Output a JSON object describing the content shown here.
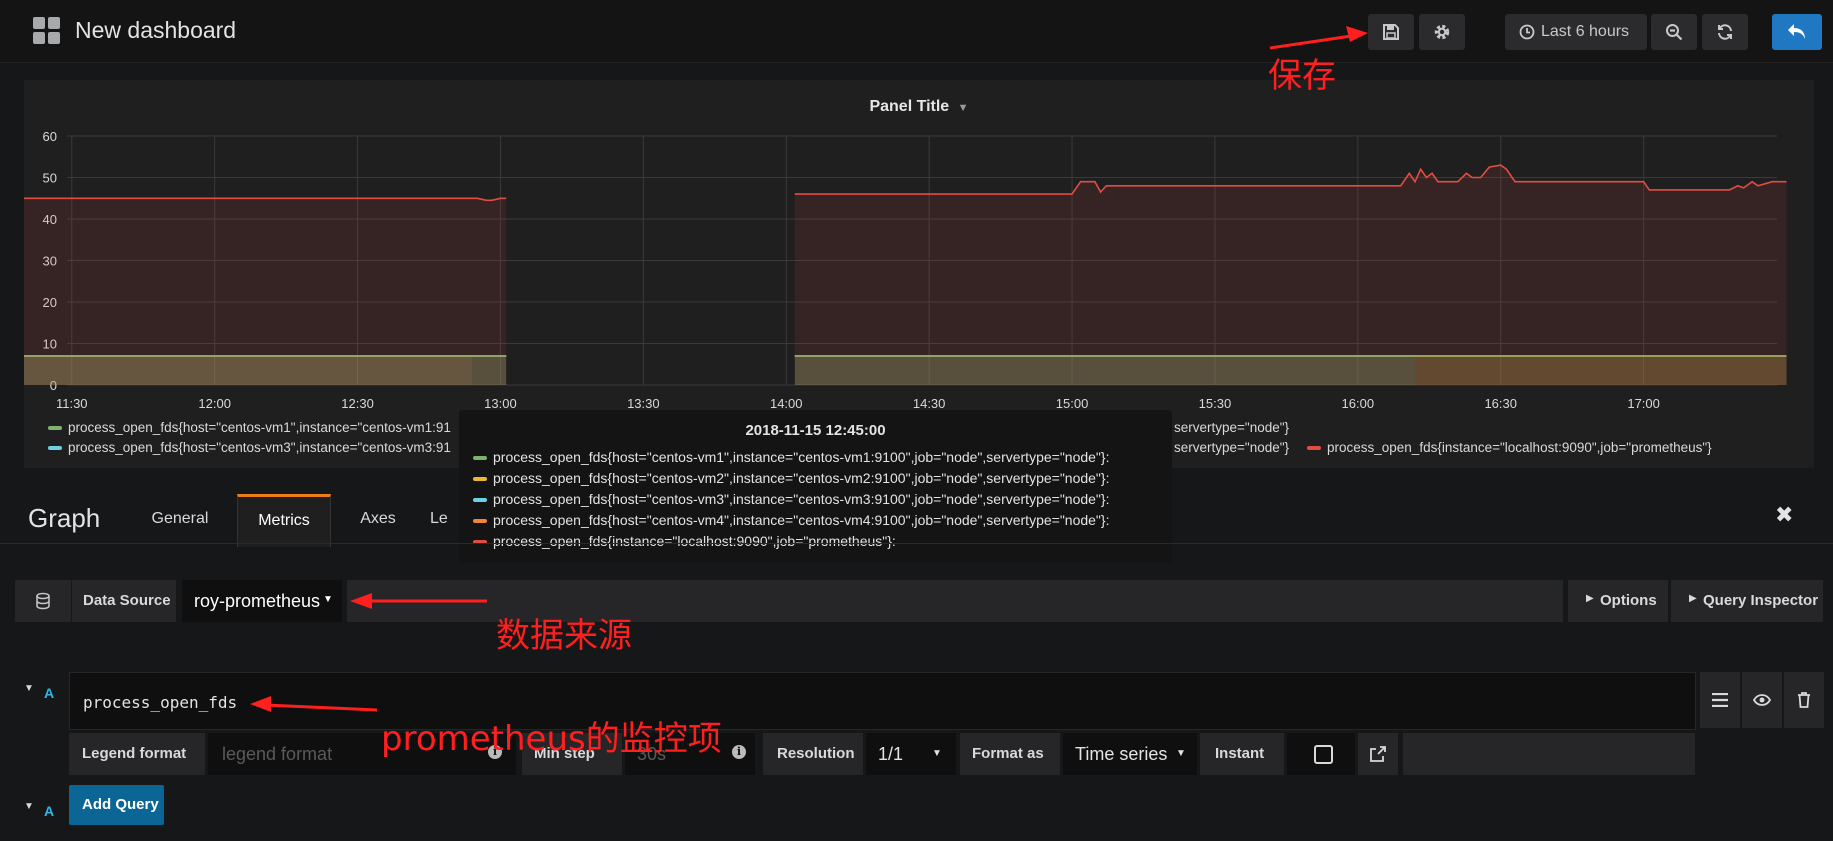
{
  "topbar": {
    "title": "New dashboard",
    "time_range": "Last 6 hours"
  },
  "panel": {
    "title": "Panel Title",
    "legend": [
      {
        "label": "process_open_fds{host=\"centos-vm1\",instance=\"centos-vm1:91",
        "color": "#7eb26d"
      },
      {
        "label": "servertype=\"node\"}",
        "color": "#eab839"
      },
      {
        "label": "process_open_fds{host=\"centos-vm3\",instance=\"centos-vm3:91",
        "color": "#6ed0e0"
      },
      {
        "label": "servertype=\"node\"}",
        "color": "#ef843c"
      },
      {
        "label": "process_open_fds{instance=\"localhost:9090\",job=\"prometheus\"}",
        "color": "#e24d42"
      }
    ]
  },
  "chart_data": {
    "type": "line",
    "title": "Panel Title",
    "ylim": [
      0,
      60
    ],
    "yticks": [
      "0",
      "10",
      "20",
      "30",
      "40",
      "50",
      "60"
    ],
    "xticks": [
      "11:30",
      "12:00",
      "12:30",
      "13:00",
      "13:30",
      "14:00",
      "14:30",
      "15:00",
      "15:30",
      "16:00",
      "16:30",
      "17:00"
    ],
    "grid": true,
    "series": [
      {
        "name": "process_open_fds{instance=\"localhost:9090\",job=\"prometheus\"}",
        "color": "#e24d42",
        "segments": [
          [
            [
              11.33,
              45
            ],
            [
              12.92,
              45
            ],
            [
              12.95,
              44.5
            ],
            [
              12.97,
              44.5
            ],
            [
              13.0,
              45
            ],
            [
              13.02,
              45
            ]
          ],
          [
            [
              14.03,
              46
            ],
            [
              15.0,
              46
            ],
            [
              15.03,
              49
            ],
            [
              15.08,
              49
            ],
            [
              15.1,
              46.5
            ],
            [
              15.12,
              48
            ],
            [
              16.0,
              48
            ],
            [
              16.15,
              48
            ],
            [
              16.18,
              51
            ],
            [
              16.2,
              49
            ],
            [
              16.22,
              52
            ],
            [
              16.24,
              50
            ],
            [
              16.26,
              51
            ],
            [
              16.28,
              49
            ],
            [
              16.35,
              49
            ],
            [
              16.38,
              51
            ],
            [
              16.4,
              50
            ],
            [
              16.43,
              50
            ],
            [
              16.46,
              52.5
            ],
            [
              16.5,
              53
            ],
            [
              16.52,
              52
            ],
            [
              16.55,
              49
            ],
            [
              17.0,
              49
            ],
            [
              17.02,
              47
            ],
            [
              17.3,
              47
            ],
            [
              17.33,
              48
            ],
            [
              17.35,
              47.5
            ],
            [
              17.38,
              49
            ],
            [
              17.4,
              48
            ],
            [
              17.45,
              49
            ],
            [
              17.5,
              49
            ]
          ]
        ]
      },
      {
        "name": "process_open_fds{host=\"centos-vm1\",instance=\"centos-vm1:9100\",job=\"node\",servertype=\"node\"}",
        "color": "#7eb26d",
        "segments": [
          [
            [
              11.33,
              7
            ],
            [
              13.02,
              7
            ]
          ],
          [
            [
              14.03,
              7
            ],
            [
              17.5,
              7
            ]
          ]
        ]
      },
      {
        "name": "process_open_fds{host=\"centos-vm2\",instance=\"centos-vm2:9100\",job=\"node\",servertype=\"node\"}",
        "color": "#eab839",
        "segments": [
          [
            [
              11.33,
              7
            ],
            [
              13.02,
              7
            ]
          ],
          [
            [
              14.03,
              7
            ],
            [
              17.5,
              7
            ]
          ]
        ]
      },
      {
        "name": "process_open_fds{host=\"centos-vm3\",instance=\"centos-vm3:9100\",job=\"node\",servertype=\"node\"}",
        "color": "#6ed0e0",
        "segments": [
          [
            [
              11.33,
              7
            ],
            [
              13.02,
              7
            ]
          ],
          [
            [
              14.03,
              7
            ],
            [
              16.2,
              7
            ]
          ]
        ]
      },
      {
        "name": "process_open_fds{host=\"centos-vm4\",instance=\"centos-vm4:9100\",job=\"node\",servertype=\"node\"}",
        "color": "#ef843c",
        "segments": [
          [
            [
              11.33,
              7
            ],
            [
              12.9,
              7
            ]
          ],
          [
            [
              16.2,
              7
            ],
            [
              17.5,
              7
            ]
          ]
        ]
      }
    ]
  },
  "tooltip": {
    "title": "2018-11-15 12:45:00",
    "rows": [
      {
        "label": "process_open_fds{host=\"centos-vm1\",instance=\"centos-vm1:9100\",job=\"node\",servertype=\"node\"}:",
        "color": "#7eb26d"
      },
      {
        "label": "process_open_fds{host=\"centos-vm2\",instance=\"centos-vm2:9100\",job=\"node\",servertype=\"node\"}:",
        "color": "#eab839"
      },
      {
        "label": "process_open_fds{host=\"centos-vm3\",instance=\"centos-vm3:9100\",job=\"node\",servertype=\"node\"}:",
        "color": "#6ed0e0"
      },
      {
        "label": "process_open_fds{host=\"centos-vm4\",instance=\"centos-vm4:9100\",job=\"node\",servertype=\"node\"}:",
        "color": "#ef843c"
      },
      {
        "label": "process_open_fds{instance=\"localhost:9090\",job=\"prometheus\"}:",
        "color": "#e24d42"
      }
    ]
  },
  "editor": {
    "panel_type": "Graph",
    "tabs": [
      "General",
      "Metrics",
      "Axes",
      "Le"
    ],
    "active_tab": "Metrics",
    "data_source_label": "Data Source",
    "data_source_value": "roy-prometheus",
    "options_label": "Options",
    "query_inspector_label": "Query Inspector",
    "query_letter": "A",
    "query_expr": "process_open_fds",
    "legend_format_label": "Legend format",
    "legend_format_placeholder": "legend format",
    "min_step_label": "Min step",
    "min_step_placeholder": "30s",
    "resolution_label": "Resolution",
    "resolution_value": "1/1",
    "format_as_label": "Format as",
    "format_as_value": "Time series",
    "instant_label": "Instant",
    "add_query_letter": "A",
    "add_query_label": "Add Query"
  },
  "annotations": {
    "save": "保存",
    "data_source": "数据来源",
    "metric": "prometheus的监控项"
  }
}
